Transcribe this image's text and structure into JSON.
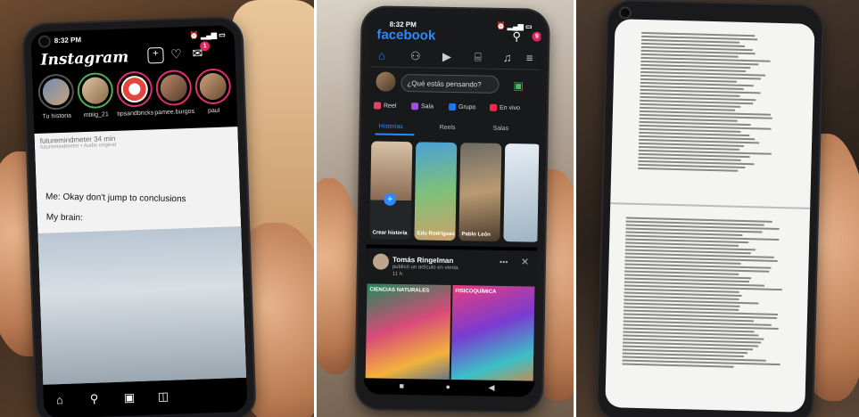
{
  "panel1": {
    "status_time": "8:32 PM",
    "app_title": "Instagram",
    "notification_count": "1",
    "stories": [
      {
        "name": "Tu historia"
      },
      {
        "name": "mtiiig_21"
      },
      {
        "name": "tipsandbricks"
      },
      {
        "name": "pamee.burgos"
      },
      {
        "name": "paul"
      }
    ],
    "post_author": "futuremindmeter",
    "post_time": "34 min",
    "post_audio": "futuremindmeter • Audio original",
    "meme_line1": "Me: Okay don't jump to conclusions",
    "meme_line2": "My brain:"
  },
  "panel2": {
    "status_time": "8:32 PM",
    "app_title": "facebook",
    "notification_count": "9",
    "composer_placeholder": "¿Qué estás pensando?",
    "actions": [
      {
        "label": "Reel",
        "color": "#e4405f"
      },
      {
        "label": "Sala",
        "color": "#9b51e0"
      },
      {
        "label": "Grupo",
        "color": "#1877f2"
      },
      {
        "label": "En vivo",
        "color": "#f02849"
      }
    ],
    "subtabs": [
      "Historias",
      "Reels",
      "Salas"
    ],
    "stories": [
      {
        "label": "Crear historia"
      },
      {
        "label": "Edu Rodríguez"
      },
      {
        "label": "Pablo León"
      },
      {
        "label": ""
      }
    ],
    "post_author": "Tomás Ringelman",
    "post_action": "publicó un artículo en venta.",
    "post_time": "11 h",
    "images": [
      {
        "label": "CIENCIAS NATURALES"
      },
      {
        "label": "FISICOQUÍMICA"
      }
    ]
  }
}
